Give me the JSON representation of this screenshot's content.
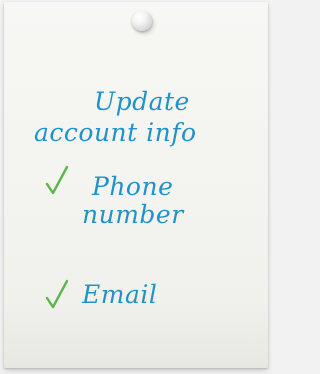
{
  "note": {
    "title_lines": [
      "Update",
      "account info"
    ],
    "items": [
      {
        "lines": [
          "Phone",
          "number"
        ],
        "checked": true
      },
      {
        "lines": [
          "Email"
        ],
        "checked": true
      }
    ]
  },
  "colors": {
    "ink": "#1f93c9",
    "check": "#59b84c",
    "paper": "#f5f5f2",
    "pin": "#e6e6e6"
  },
  "icons": {
    "pin": "pushpin-icon",
    "check": "checkmark-icon"
  }
}
